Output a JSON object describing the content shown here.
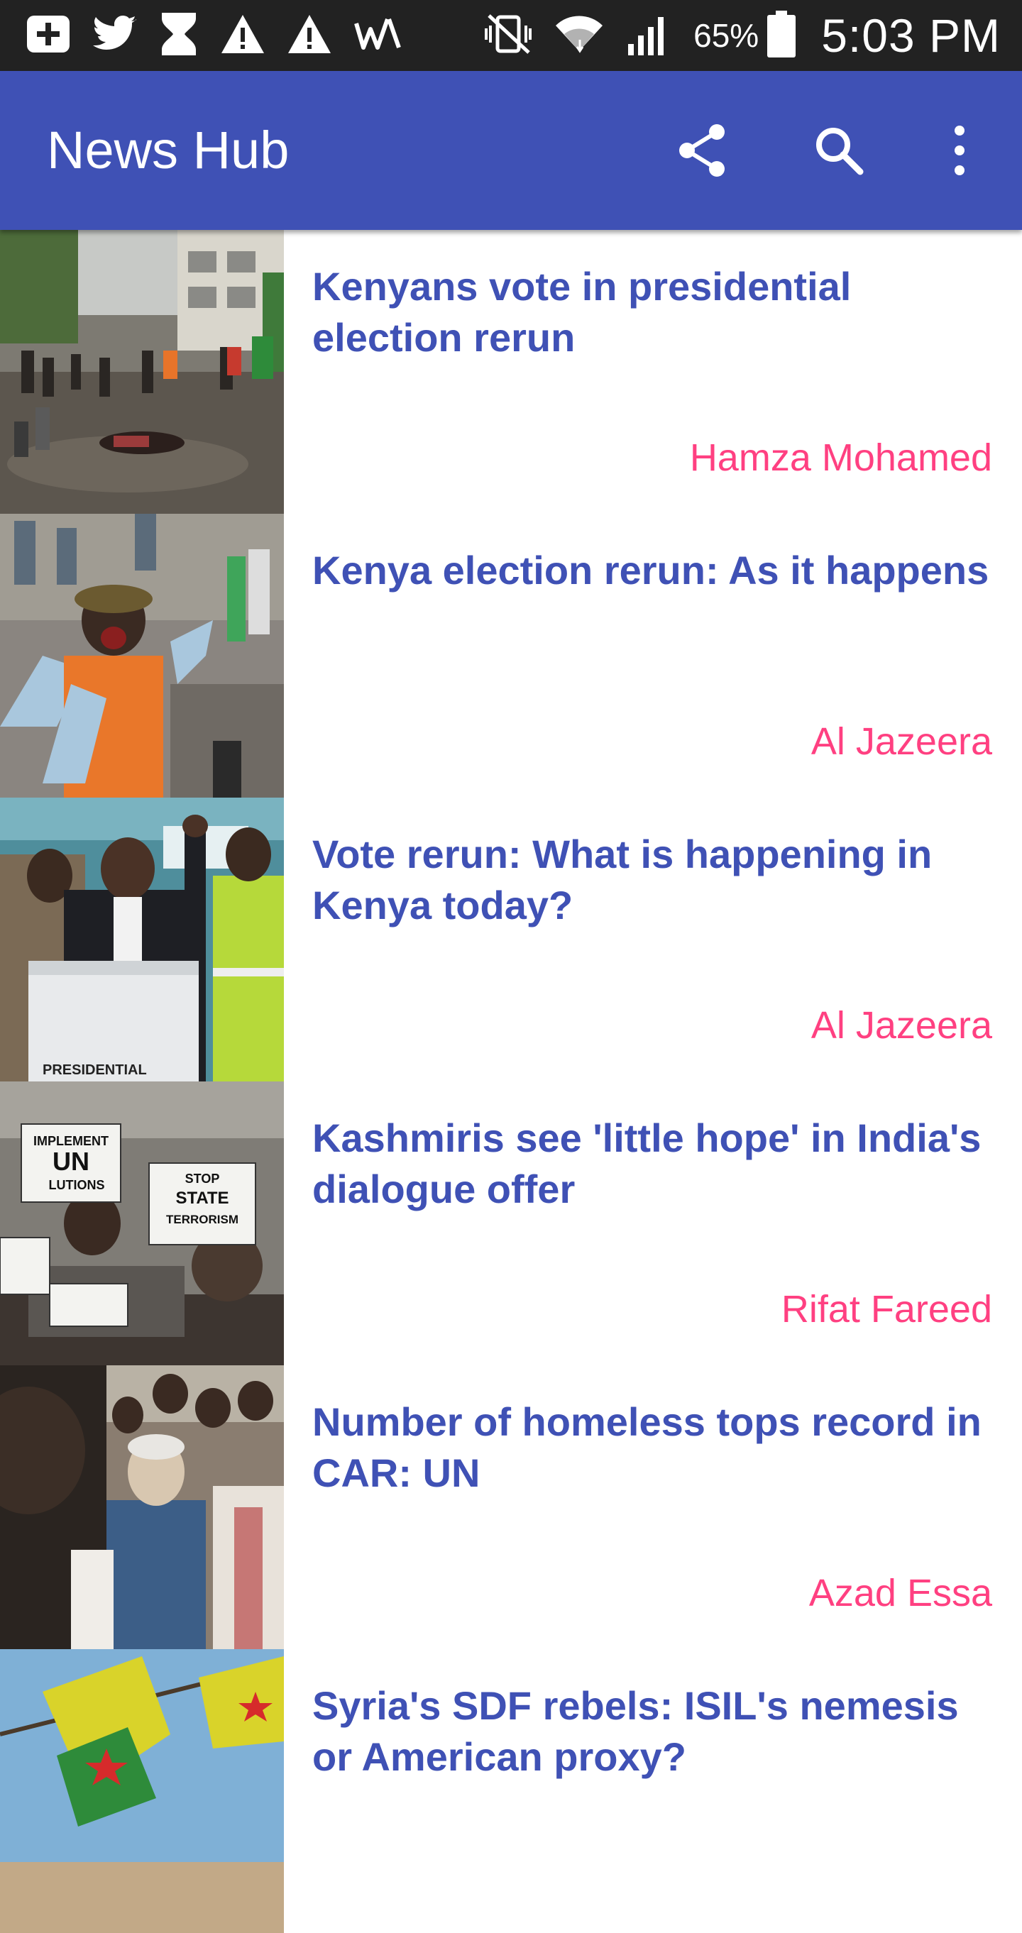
{
  "status_bar": {
    "icons": [
      "add-box-icon",
      "twitter-icon",
      "hourglass-icon",
      "warning-icon",
      "warning-icon",
      "w-logo-icon",
      "vibrate-off-icon",
      "wifi-icon",
      "cell-signal-icon",
      "battery-icon"
    ],
    "battery": "65%",
    "time": "5:03 PM"
  },
  "app_bar": {
    "title": "News Hub",
    "actions": [
      "share-icon",
      "search-icon",
      "more-vert-icon"
    ],
    "color": "#3f51b5"
  },
  "colors": {
    "headline": "#3f51b5",
    "source": "#ff4081",
    "status_bar": "#222222"
  },
  "articles": [
    {
      "title": "Kenyans vote in presidential election rerun",
      "source": "Hamza Mohamed"
    },
    {
      "title": "Kenya election rerun: As it happens",
      "source": "Al Jazeera"
    },
    {
      "title": "Vote rerun: What is happening in Kenya today?",
      "source": "Al Jazeera"
    },
    {
      "title": "Kashmiris see 'little hope' in India's dialogue offer",
      "source": "Rifat Fareed"
    },
    {
      "title": "Number of homeless tops record in CAR: UN",
      "source": "Azad Essa"
    },
    {
      "title": "Syria's SDF rebels: ISIL's nemesis or American proxy?",
      "source": ""
    }
  ],
  "thumb_signs": {
    "implement": "IMPLEMENT",
    "un": "UN",
    "resolutions": "LUTIONS",
    "stop": "STOP",
    "state": "STATE",
    "terrorism": "TERRORISM",
    "presidential": "PRESIDENTIAL"
  }
}
